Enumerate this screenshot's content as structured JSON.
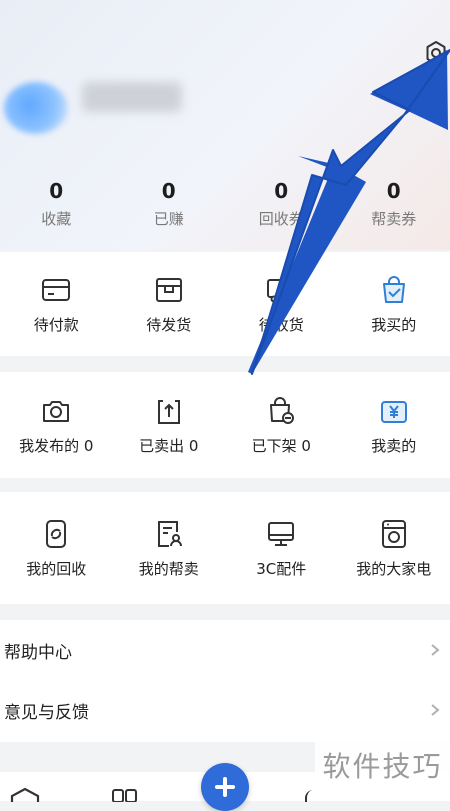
{
  "stats": [
    {
      "value": "0",
      "label": "收藏"
    },
    {
      "value": "0",
      "label": "已赚"
    },
    {
      "value": "0",
      "label": "回收券"
    },
    {
      "value": "0",
      "label": "帮卖券"
    }
  ],
  "buy_row": [
    "待付款",
    "待发货",
    "待收货",
    "我买的"
  ],
  "sell_row": [
    "我发布的 0",
    "已卖出 0",
    "已下架 0",
    "我卖的"
  ],
  "services_row": [
    "我的回收",
    "我的帮卖",
    "3C配件",
    "我的大家电"
  ],
  "menu": [
    "帮助中心",
    "意见与反馈"
  ],
  "watermark": "软件技巧",
  "colors": {
    "accent": "#2f6bd9",
    "arrow": "#1f56c4",
    "icon_blue": "#2f7fd6"
  }
}
